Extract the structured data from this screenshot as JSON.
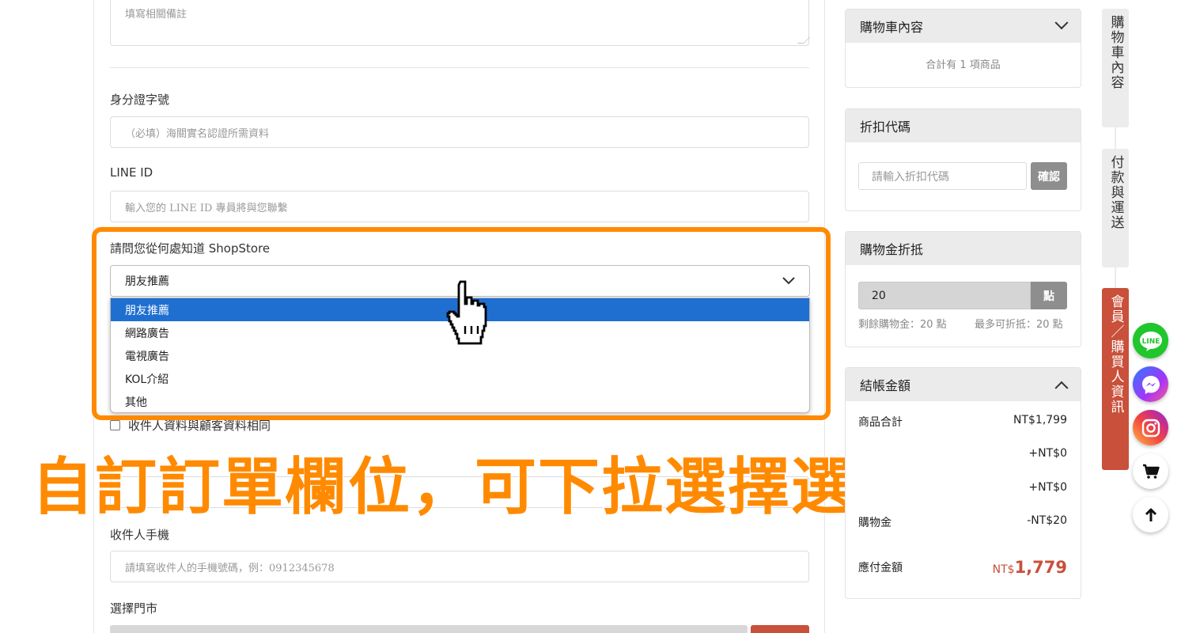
{
  "form": {
    "remarks_placeholder": "填寫相關備註",
    "id_label": "身分證字號",
    "id_placeholder": "（必填）海關實名認證所需資料",
    "line_label": "LINE ID",
    "line_placeholder": "輸入您的 LINE ID 專員將與您聯繫",
    "source_question": "請問您從何處知道 ShopStore",
    "source_selected": "朋友推薦",
    "source_options": [
      "朋友推薦",
      "網路廣告",
      "電視廣告",
      "KOL介紹",
      "其他"
    ],
    "same_as_customer": "收件人資料與顧客資料相同",
    "phone_label": "收件人手機",
    "phone_placeholder": "請填寫收件人的手機號碼，例：0912345678",
    "store_label": "選擇門市"
  },
  "caption": "自訂訂單欄位，可下拉選擇選項",
  "cart": {
    "title": "購物車內容",
    "count_text": "合計有 1 項商品"
  },
  "discount": {
    "title": "折扣代碼",
    "placeholder": "請輸入折扣代碼",
    "confirm_label": "確認"
  },
  "points": {
    "title": "購物金折抵",
    "value": "20",
    "unit": "點",
    "remaining": "剩餘購物金：20 點",
    "max_offset": "最多可折抵：20 點"
  },
  "checkout": {
    "title": "結帳金額",
    "rows": [
      {
        "label": "商品合計",
        "value": "NT$1,799"
      },
      {
        "label": "",
        "value": "+NT$0"
      },
      {
        "label": "",
        "value": "+NT$0"
      },
      {
        "label": "購物金",
        "value": "-NT$20"
      }
    ],
    "total_label": "應付金額",
    "total_currency": "NT$",
    "total_amount": "1,779"
  },
  "side_tabs": {
    "cart": "購物車內容",
    "payment": "付款與運送",
    "member": "會員／購買人資訊"
  },
  "colors": {
    "accent_orange": "#ff8a00",
    "brand_red": "#c9503a",
    "select_blue": "#1f6fd1"
  },
  "icons": {
    "line": "line-icon",
    "messenger": "messenger-icon",
    "instagram": "instagram-icon",
    "cart": "cart-icon",
    "top": "arrow-up-icon"
  }
}
